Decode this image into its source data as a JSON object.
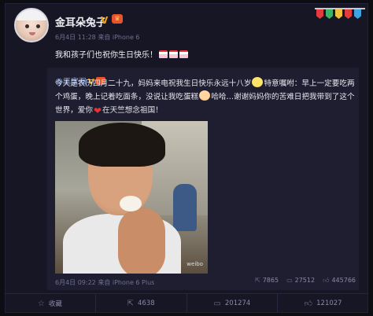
{
  "post": {
    "author": "金耳朵兔子",
    "meta": "6月4日 11:28 来自 iPhone 6",
    "text": "我和孩子们也祝你生日快乐！"
  },
  "repost": {
    "author": "@王宝强",
    "text_parts": [
      "今天是农历四月二十九，妈妈来电祝我生日快乐永远十八岁",
      "特意嘱咐：早上一定要吃两个鸡蛋，晚上记着吃面条，没说让我吃蛋糕",
      "哈哈…谢谢妈妈你的苦难日把我带到了这个世界，爱你",
      "在天竺想念祖国！"
    ],
    "photo_watermark": "weibo",
    "meta": "6月4日 09:22 来自 iPhone 6 Plus",
    "stats": {
      "reposts": "7865",
      "comments": "27512",
      "likes": "445766"
    }
  },
  "footer": {
    "favorite": "收藏",
    "reposts": "4638",
    "comments": "201274",
    "likes": "121027"
  },
  "icons": {
    "repost": "repost-icon",
    "comment": "comment-icon",
    "like": "like-icon",
    "favorite": "star-icon"
  }
}
